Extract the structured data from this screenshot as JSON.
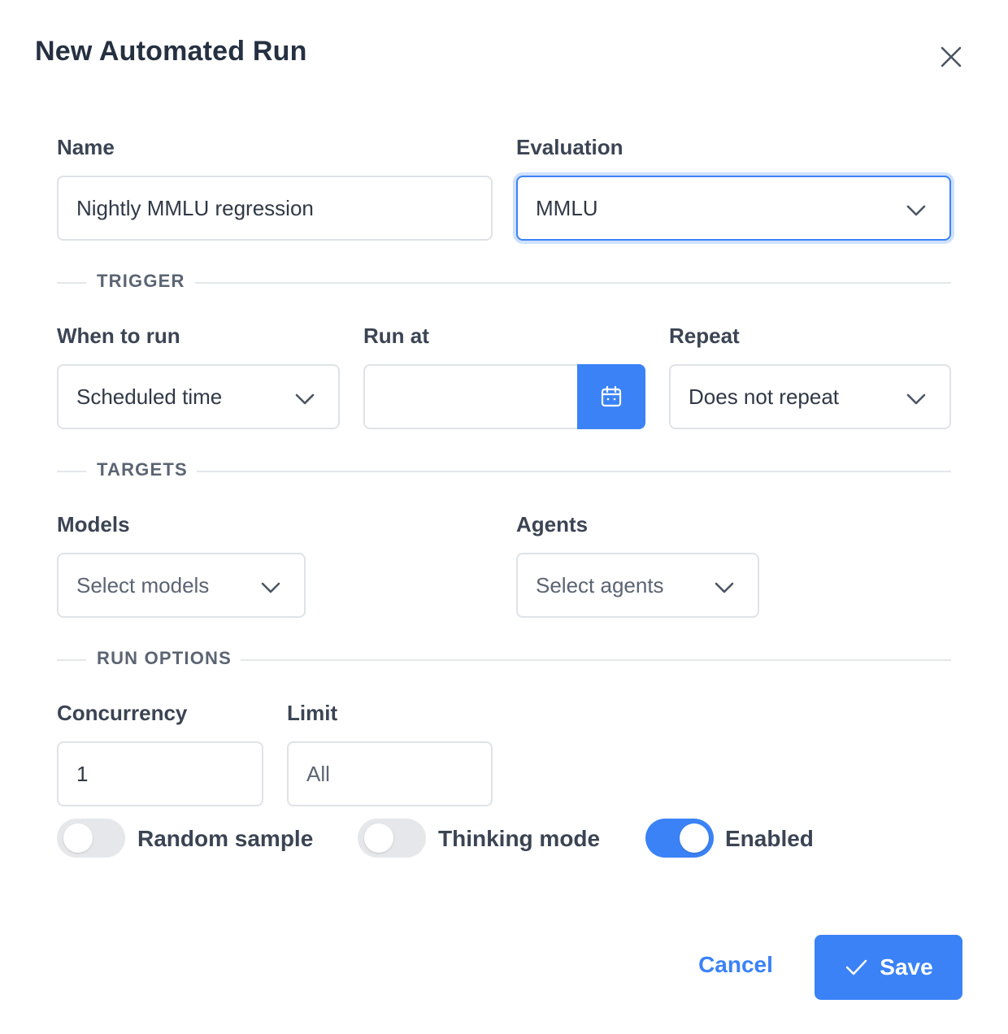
{
  "dialog": {
    "title": "New Automated Run",
    "close_icon": "close-icon"
  },
  "fields": {
    "name": {
      "label": "Name",
      "value": "Nightly MMLU regression"
    },
    "evaluation": {
      "label": "Evaluation",
      "value": "MMLU"
    },
    "when_to_run": {
      "label": "When to run",
      "value": "Scheduled time"
    },
    "run_at": {
      "label": "Run at",
      "value": "",
      "icon": "calendar-icon"
    },
    "repeat": {
      "label": "Repeat",
      "value": "Does not repeat"
    },
    "models": {
      "label": "Models",
      "placeholder": "Select models"
    },
    "agents": {
      "label": "Agents",
      "placeholder": "Select agents"
    },
    "concurrency": {
      "label": "Concurrency",
      "value": "1"
    },
    "limit": {
      "label": "Limit",
      "placeholder": "All"
    }
  },
  "sections": {
    "trigger": "TRIGGER",
    "targets": "TARGETS",
    "run_options": "RUN OPTIONS"
  },
  "toggles": [
    {
      "label": "Random sample",
      "on": false
    },
    {
      "label": "Thinking mode",
      "on": false
    },
    {
      "label": "Enabled",
      "on": true
    }
  ],
  "footer": {
    "cancel_label": "Cancel",
    "save_label": "Save",
    "save_icon": "check-icon"
  },
  "colors": {
    "accent": "#3b82f6",
    "focus_ring": "#cfe1fd",
    "border": "#dfe3e8",
    "toggle_off": "#e5e7eb"
  }
}
